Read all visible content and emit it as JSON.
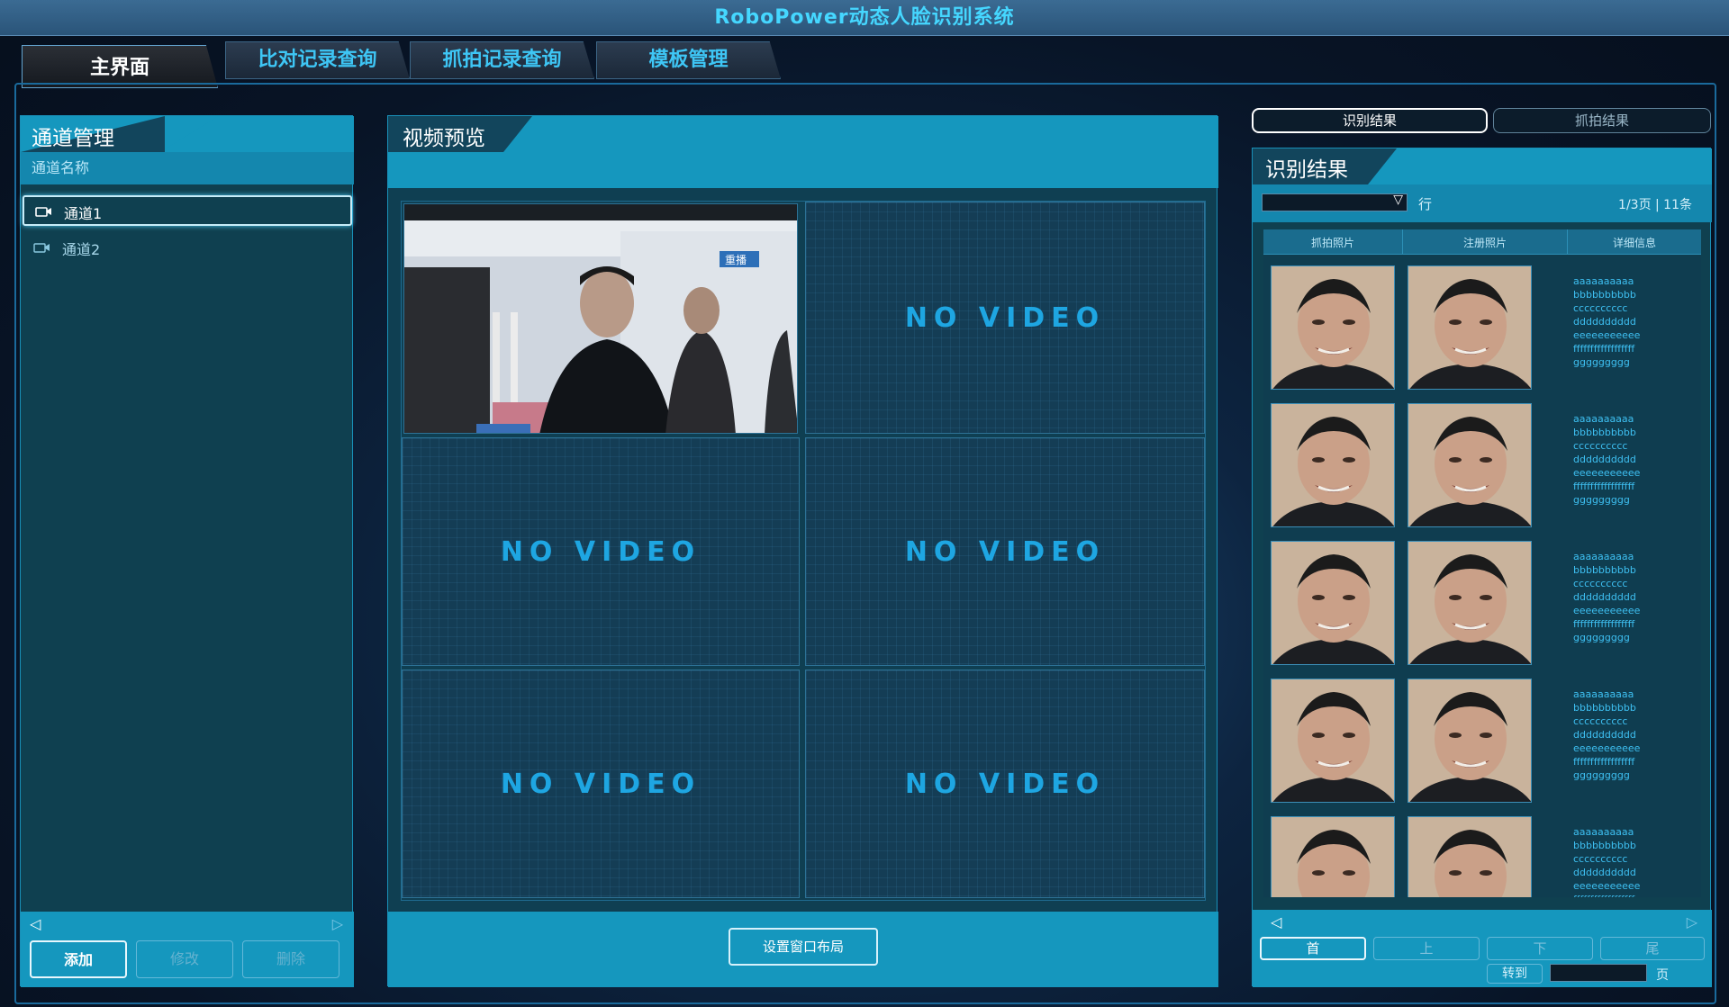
{
  "app": {
    "title": "RoboPower动态人脸识别系统"
  },
  "tabs": [
    "主界面",
    "比对记录查询",
    "抓拍记录查询",
    "模板管理"
  ],
  "channels": {
    "title": "通道管理",
    "column": "通道名称",
    "items": [
      "通道1",
      "通道2"
    ],
    "buttons": {
      "add": "添加",
      "edit": "修改",
      "delete": "删除"
    }
  },
  "video": {
    "title": "视频预览",
    "no_video": "NO VIDEO",
    "layout_button": "设置窗口布局",
    "cells": 6
  },
  "results": {
    "toggle": [
      "识别结果",
      "抓拍结果"
    ],
    "title": "识别结果",
    "rows_label": "行",
    "page_info": "1/3页 | 11条",
    "columns": [
      "抓拍照片",
      "注册照片",
      "详细信息"
    ],
    "detail_lines": [
      "aaaaaaaaaa",
      "bbbbbbbbbb",
      "cccccccccc",
      "dddddddddd",
      "eeeeeeeeeee",
      "ffffffffffffffffff",
      "ggggggggg"
    ],
    "pager": {
      "first": "首",
      "prev": "上",
      "next": "下",
      "last": "尾",
      "goto": "转到",
      "page_unit": "页"
    }
  }
}
